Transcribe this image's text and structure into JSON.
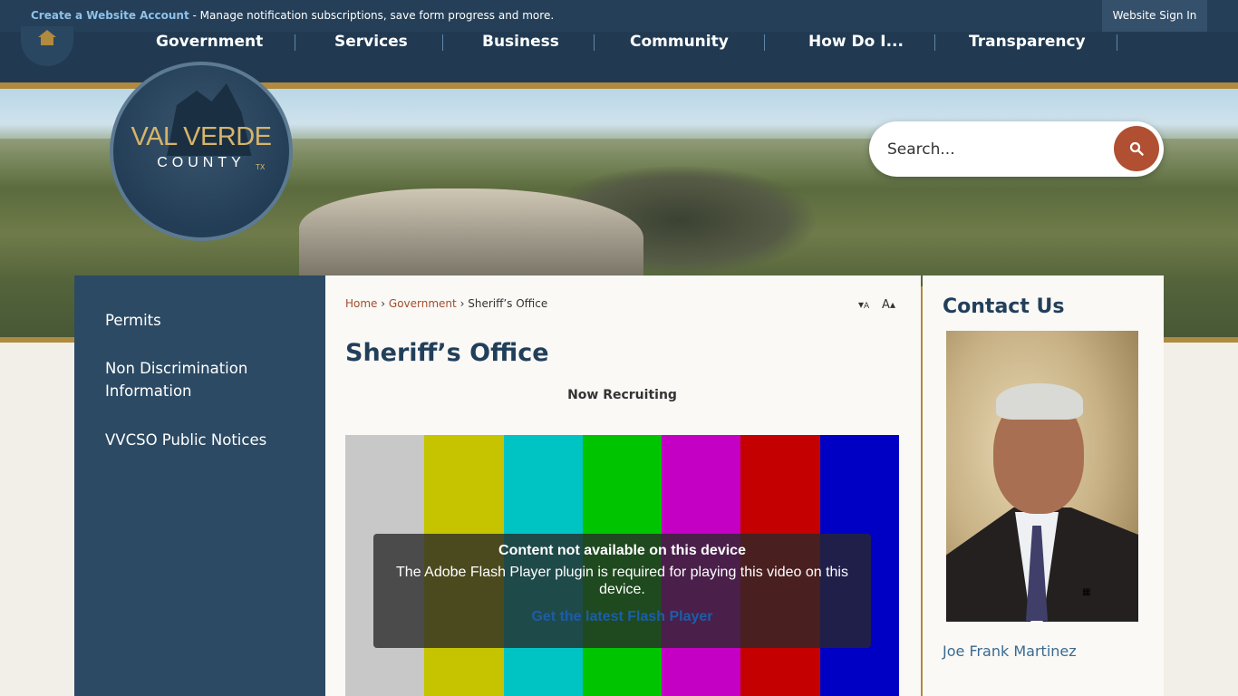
{
  "topbar": {
    "create_account_link": "Create a Website Account",
    "message": " - Manage notification subscriptions, save form progress and more.",
    "sign_in": "Website Sign In"
  },
  "nav": {
    "items": [
      "Government",
      "Services",
      "Business",
      "Community",
      "How Do I...",
      "Transparency"
    ]
  },
  "logo": {
    "line1": "VAL VERDE",
    "line2": "COUNTY",
    "state": "TX"
  },
  "search": {
    "placeholder": "Search..."
  },
  "sidebar": {
    "items": [
      "Permits",
      "Non Discrimination Information",
      "VVCSO Public Notices"
    ]
  },
  "breadcrumb": {
    "home": "Home",
    "sep": "›",
    "section": "Government",
    "current": "Sheriff’s Office"
  },
  "font_controls": {
    "decrease": "A",
    "increase": "A"
  },
  "main": {
    "title": "Sheriff’s Office",
    "subtitle": "Now Recruiting"
  },
  "video": {
    "bar_colors": [
      "#c8c8c8",
      "#c6c400",
      "#00c4c4",
      "#00c400",
      "#c400c4",
      "#c40000",
      "#0000c4"
    ],
    "notice_title": "Content not available on this device",
    "notice_text": "The Adobe Flash Player plugin is required for playing this video on this device.",
    "notice_link": "Get the latest Flash Player"
  },
  "contact": {
    "heading": "Contact Us",
    "name": "Joe Frank Martinez"
  }
}
